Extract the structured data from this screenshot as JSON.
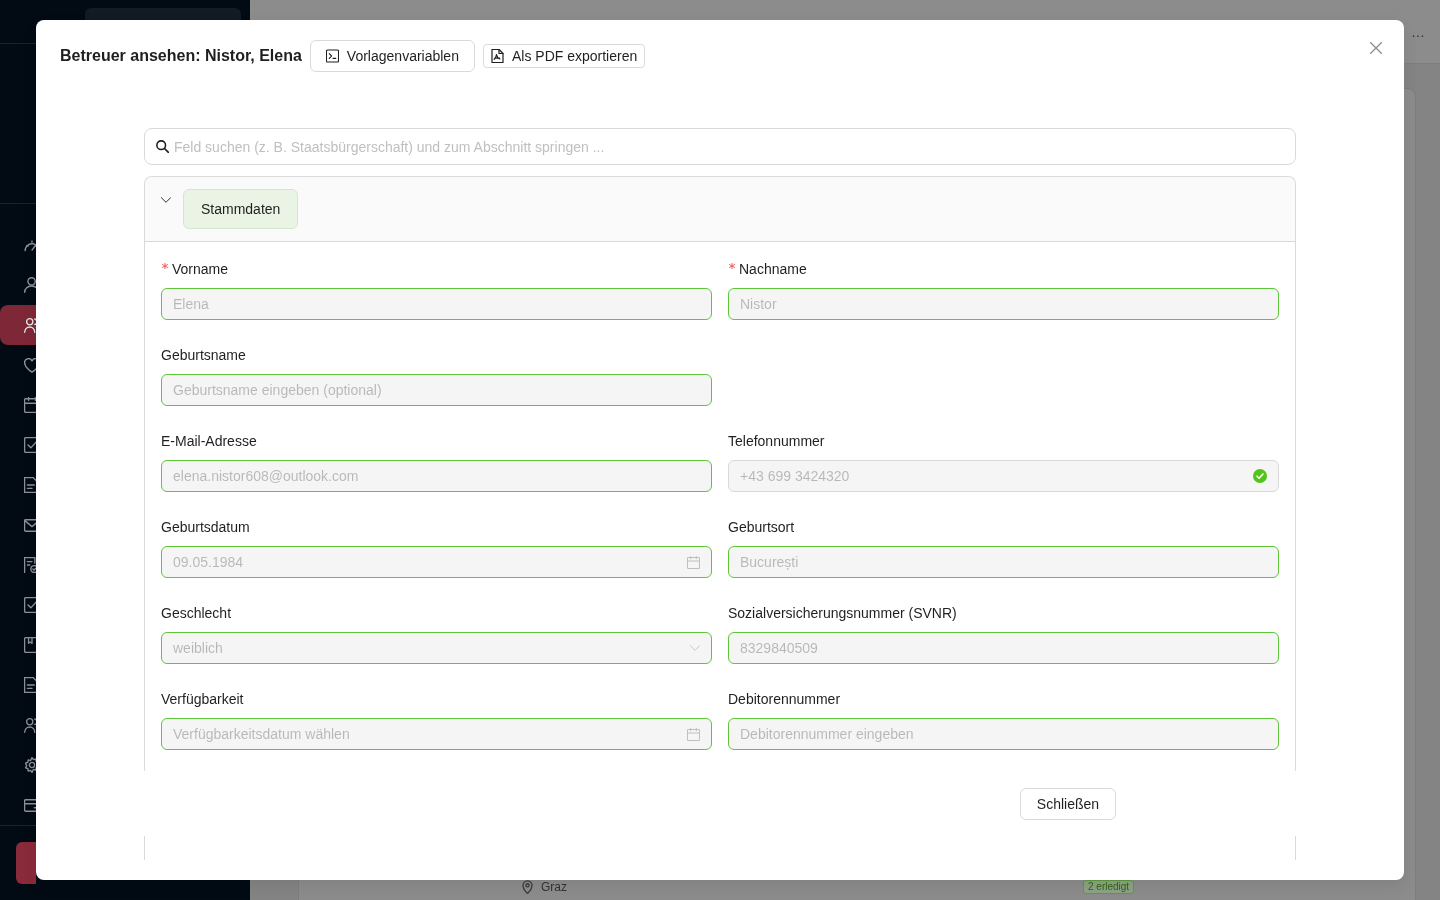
{
  "background": {
    "sidebar": {
      "items": [
        {
          "selected": false
        },
        {
          "selected": false
        },
        {
          "selected": true
        },
        {
          "selected": false
        },
        {
          "selected": false
        },
        {
          "selected": false
        },
        {
          "selected": false
        },
        {
          "selected": false
        },
        {
          "selected": false
        },
        {
          "selected": false
        },
        {
          "selected": false
        },
        {
          "selected": false
        },
        {
          "selected": false
        },
        {
          "selected": false
        },
        {
          "selected": false
        }
      ]
    },
    "header": {
      "text": "…"
    },
    "list_row": {
      "location": "Graz",
      "badge": "2 erledigt"
    }
  },
  "dialog": {
    "title": "Betreuer ansehen: Nistor, Elena",
    "actions": [
      {
        "label": "Vorlagenvariablen",
        "kind": "variables"
      },
      {
        "label": "Als PDF exportieren",
        "kind": "export"
      }
    ],
    "search": {
      "placeholder": "Feld suchen (z. B. Staatsbürgerschaft) und zum Abschnitt springen ..."
    },
    "sections": [
      {
        "title": "Stammdaten",
        "expanded": true,
        "rows": [
          [
            {
              "label": "Vorname",
              "required": true,
              "kind": "text",
              "value": "Elena",
              "disabled": true,
              "valid": true,
              "verified": false
            },
            {
              "label": "Nachname",
              "required": true,
              "kind": "text",
              "value": "Nistor",
              "disabled": true,
              "valid": true,
              "verified": false
            }
          ],
          [
            {
              "label": "Geburtsname",
              "required": false,
              "kind": "text",
              "placeholder": "Geburtsname eingeben (optional)",
              "disabled": true,
              "valid": true,
              "verified": false
            }
          ],
          [
            {
              "label": "E-Mail-Adresse",
              "required": false,
              "kind": "text",
              "value": "elena.nistor608@outlook.com",
              "disabled": true,
              "valid": true,
              "verified": false
            },
            {
              "label": "Telefonnummer",
              "required": false,
              "kind": "text",
              "value": "+43 699 3424320",
              "disabled": true,
              "valid": false,
              "verified": true
            }
          ],
          [
            {
              "label": "Geburtsdatum",
              "required": false,
              "kind": "date",
              "value": "09.05.1984",
              "disabled": true,
              "valid": true,
              "verified": false
            },
            {
              "label": "Geburtsort",
              "required": false,
              "kind": "text",
              "value": "București",
              "disabled": true,
              "valid": true,
              "verified": false
            }
          ],
          [
            {
              "label": "Geschlecht",
              "required": false,
              "kind": "select",
              "value": "weiblich",
              "disabled": true,
              "valid": true,
              "verified": false
            },
            {
              "label": "Sozialversicherungsnummer (SVNR)",
              "required": false,
              "kind": "text",
              "value": "8329840509",
              "disabled": true,
              "valid": true,
              "verified": false
            }
          ],
          [
            {
              "label": "Verfügbarkeit",
              "required": false,
              "kind": "date",
              "placeholder": "Verfügbarkeitsdatum wählen",
              "disabled": true,
              "valid": true,
              "verified": false
            },
            {
              "label": "Debitorennummer",
              "required": false,
              "kind": "text",
              "placeholder": "Debitorennummer eingeben",
              "disabled": true,
              "valid": true,
              "verified": false
            }
          ]
        ]
      }
    ],
    "footer": {
      "buttons": [
        "Schließen"
      ]
    }
  }
}
